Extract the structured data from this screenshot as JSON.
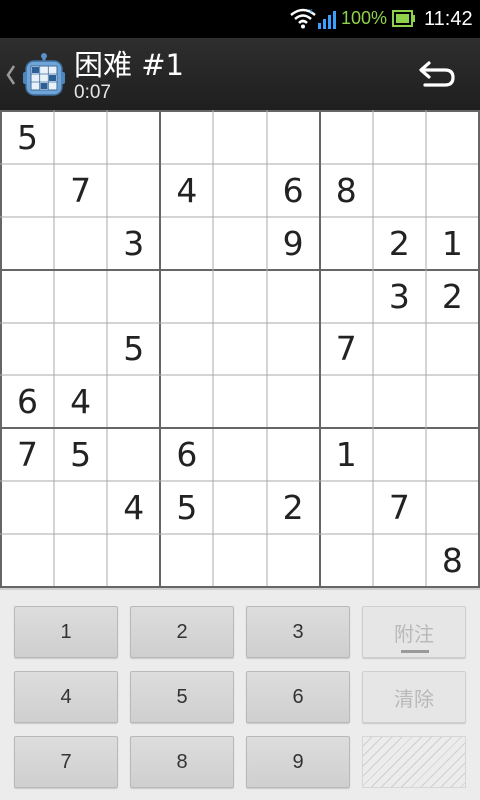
{
  "status_bar": {
    "battery_percent": "100%",
    "time": "11:42",
    "battery_color": "#8ed14a"
  },
  "action_bar": {
    "title": "困难 #1",
    "timer": "0:07",
    "icons": [
      "up-chevron-icon",
      "sudoku-app-icon",
      "undo-icon"
    ]
  },
  "board": {
    "grid": [
      [
        "5",
        "",
        "",
        "",
        "",
        "",
        "",
        "",
        ""
      ],
      [
        "",
        "7",
        "",
        "4",
        "",
        "6",
        "8",
        "",
        ""
      ],
      [
        "",
        "",
        "3",
        "",
        "",
        "9",
        "",
        "2",
        "1"
      ],
      [
        "",
        "",
        "",
        "",
        "",
        "",
        "",
        "3",
        "2"
      ],
      [
        "",
        "",
        "5",
        "",
        "",
        "",
        "7",
        "",
        ""
      ],
      [
        "6",
        "4",
        "",
        "",
        "",
        "",
        "",
        "",
        ""
      ],
      [
        "7",
        "5",
        "",
        "6",
        "",
        "",
        "1",
        "",
        ""
      ],
      [
        "",
        "",
        "4",
        "5",
        "",
        "2",
        "",
        "7",
        ""
      ],
      [
        "",
        "",
        "",
        "",
        "",
        "",
        "",
        "",
        "8"
      ]
    ]
  },
  "keypad": {
    "digits": [
      "1",
      "2",
      "3",
      "4",
      "5",
      "6",
      "7",
      "8",
      "9"
    ],
    "notes_label": "附注",
    "clear_label": "清除"
  }
}
